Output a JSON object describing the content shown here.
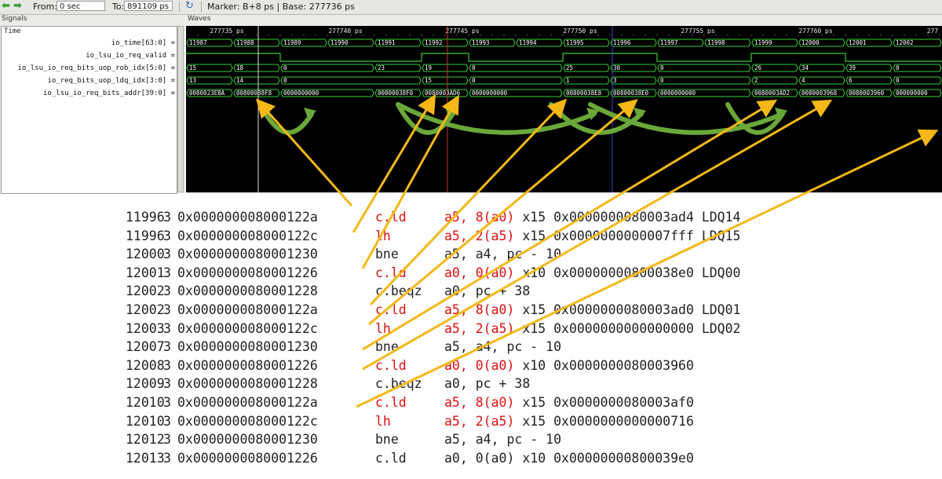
{
  "toolbar": {
    "from_label": "From:",
    "from_value": "0 sec",
    "to_label": "To:",
    "to_value": "891109 ps",
    "marker_text": "Marker: B+8 ps  |  Base: 277736 ps"
  },
  "signals": {
    "header": "Signals",
    "time_label": "Time",
    "rows": [
      "io_time[63:0] =",
      "io_lsu_io_req_valid =",
      "io_lsu_io_req_bits_uop_rob_idx[5:0] =",
      "io_req_bits_uop_ldq_idx[3:0] =",
      "io_lsu_io_req_bits_addr[39:0] ="
    ]
  },
  "waves": {
    "header": "Waves",
    "time_ticks": [
      "277735 ps",
      "277740 ps",
      "277745 ps",
      "277750 ps",
      "277755 ps",
      "277760 ps",
      "277"
    ],
    "io_time": [
      "11987",
      "11988",
      "11989",
      "11990",
      "11991",
      "11992",
      "11993",
      "11994",
      "11995",
      "11996",
      "11997",
      "11998",
      "11999",
      "12000",
      "12001",
      "12002"
    ],
    "rob_idx": [
      "15",
      "18",
      "0",
      "23",
      "19",
      "0",
      "25",
      "30",
      "0",
      "26",
      "34",
      "39",
      "0"
    ],
    "ldq_idx": [
      "13",
      "14",
      "0",
      "15",
      "0",
      "1",
      "3",
      "0",
      "2",
      "4",
      "6",
      "0"
    ],
    "addr": [
      "0080023EBA",
      "00800038F8",
      "0000000000",
      "00800038F0",
      "0080003AD6",
      "0000000000",
      "00800038E8",
      "00800038E0",
      "0000000000",
      "0080003AD2",
      "0080003968",
      "0080003960",
      "000000000"
    ]
  },
  "trace": [
    {
      "cycle": "11996",
      "id": "3",
      "pc": "0x000000008000122a",
      "op": "c.ld",
      "args": "a5, 8(a0)",
      "rest": " x15 0x0000000080003ad4 LDQ14",
      "op_red": true,
      "args_red": true
    },
    {
      "cycle": "11996",
      "id": "3",
      "pc": "0x000000008000122c",
      "op": "lh",
      "args": "a5, 2(a5)",
      "rest": " x15 0x0000000000007fff LDQ15",
      "op_red": true,
      "args_red": true
    },
    {
      "cycle": "12000",
      "id": "3",
      "pc": "0x0000000080001230",
      "op": "bne",
      "args": "a5, a4, pc - 10",
      "rest": "",
      "op_red": false,
      "args_red": false
    },
    {
      "cycle": "12001",
      "id": "3",
      "pc": "0x0000000080001226",
      "op": "c.ld",
      "args": "a0, 0(a0)",
      "rest": " x10 0x00000000800038e0 LDQ00",
      "op_red": true,
      "args_red": true
    },
    {
      "cycle": "12002",
      "id": "3",
      "pc": "0x0000000080001228",
      "op": "c.beqz",
      "args": "a0, pc + 38",
      "rest": "",
      "op_red": false,
      "args_red": false
    },
    {
      "cycle": "12002",
      "id": "3",
      "pc": "0x000000008000122a",
      "op": "c.ld",
      "args": "a5, 8(a0)",
      "rest": " x15 0x0000000080003ad0 LDQ01",
      "op_red": true,
      "args_red": true
    },
    {
      "cycle": "12003",
      "id": "3",
      "pc": "0x000000008000122c",
      "op": "lh",
      "args": "a5, 2(a5)",
      "rest": " x15 0x0000000000000000 LDQ02",
      "op_red": true,
      "args_red": true
    },
    {
      "cycle": "12007",
      "id": "3",
      "pc": "0x0000000080001230",
      "op": "bne",
      "args": "a5, a4, pc - 10",
      "rest": "",
      "op_red": false,
      "args_red": false
    },
    {
      "cycle": "12008",
      "id": "3",
      "pc": "0x0000000080001226",
      "op": "c.ld",
      "args": "a0, 0(a0)",
      "rest": " x10 0x0000000080003960",
      "op_red": true,
      "args_red": true
    },
    {
      "cycle": "12009",
      "id": "3",
      "pc": "0x0000000080001228",
      "op": "c.beqz",
      "args": "a0, pc + 38",
      "rest": "",
      "op_red": false,
      "args_red": false
    },
    {
      "cycle": "12010",
      "id": "3",
      "pc": "0x000000008000122a",
      "op": "c.ld",
      "args": "a5, 8(a0)",
      "rest": " x15 0x0000000080003af0",
      "op_red": true,
      "args_red": true
    },
    {
      "cycle": "12010",
      "id": "3",
      "pc": "0x000000008000122c",
      "op": "lh",
      "args": "a5, 2(a5)",
      "rest": " x15 0x0000000000000716",
      "op_red": true,
      "args_red": true
    },
    {
      "cycle": "12012",
      "id": "3",
      "pc": "0x0000000080001230",
      "op": "bne",
      "args": "a5, a4, pc - 10",
      "rest": "",
      "op_red": false,
      "args_red": false
    },
    {
      "cycle": "12013",
      "id": "3",
      "pc": "0x0000000080001226",
      "op": "c.ld",
      "args": "a0, 0(a0)",
      "rest": " x10 0x00000000800039e0",
      "op_red": false,
      "args_red": false
    }
  ],
  "colors": {
    "wave_green": "#33cc33",
    "arrow_orange": "#f5b818",
    "curve_green": "#6aa83a",
    "highlight_red": "#e01010"
  }
}
